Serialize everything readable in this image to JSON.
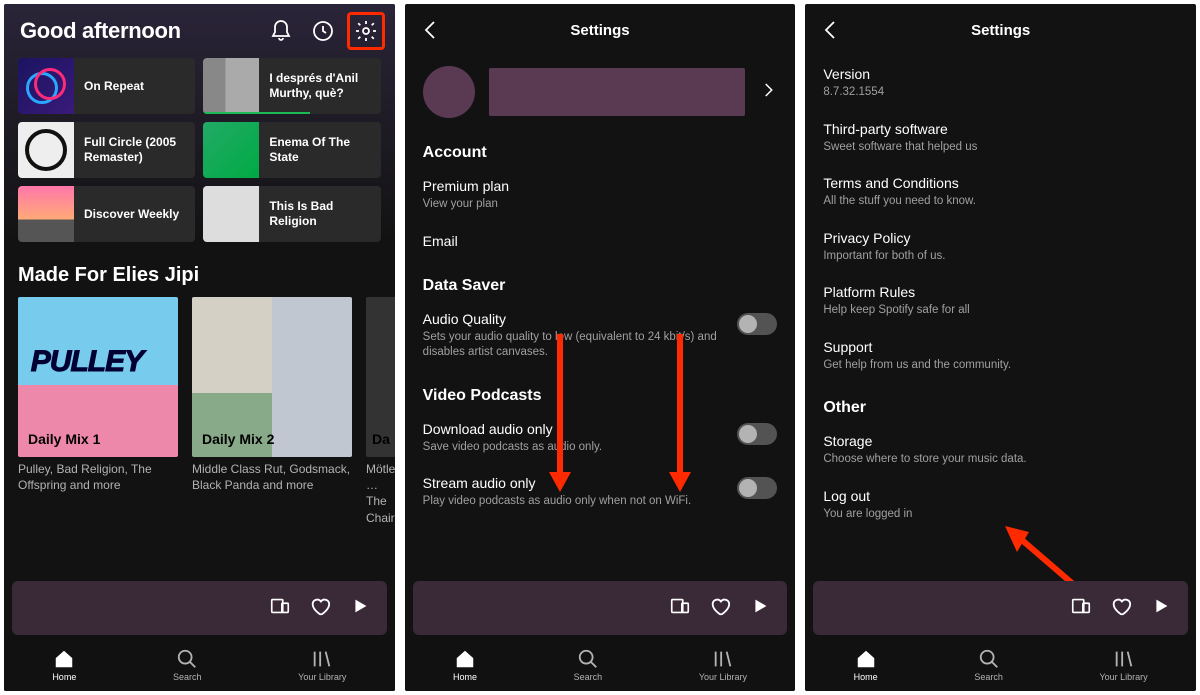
{
  "home": {
    "greeting": "Good afternoon",
    "tiles": [
      {
        "label": "On Repeat"
      },
      {
        "label": "I després d'Anil Murthy, què?"
      },
      {
        "label": "Full Circle (2005 Remaster)"
      },
      {
        "label": "Enema Of The State"
      },
      {
        "label": "Discover Weekly"
      },
      {
        "label": "This Is Bad Religion"
      }
    ],
    "made_for_heading": "Made For Elies Jipi",
    "cards": [
      {
        "name": "Daily Mix 1",
        "logo": "PULLEY",
        "sub": "Pulley, Bad Religion, The Offspring and more"
      },
      {
        "name": "Daily Mix 2",
        "sub": "Middle Class Rut, Godsmack, Black Panda and more"
      },
      {
        "name": "Da",
        "sub": "Mötley …\nThe Chair…"
      }
    ]
  },
  "nav": {
    "home": "Home",
    "search": "Search",
    "library": "Your Library"
  },
  "settings": {
    "title": "Settings",
    "account_head": "Account",
    "premium": {
      "t": "Premium plan",
      "s": "View your plan"
    },
    "email": {
      "t": "Email"
    },
    "datasaver_head": "Data Saver",
    "audio_q": {
      "t": "Audio Quality",
      "s": "Sets your audio quality to low (equivalent to 24 kbit/s) and disables artist canvases."
    },
    "video_head": "Video Podcasts",
    "dl_audio": {
      "t": "Download audio only",
      "s": "Save video podcasts as audio only."
    },
    "stream_audio": {
      "t": "Stream audio only",
      "s": "Play video podcasts as audio only when not on WiFi."
    }
  },
  "settings2": {
    "version": {
      "t": "Version",
      "s": "8.7.32.1554"
    },
    "third": {
      "t": "Third-party software",
      "s": "Sweet software that helped us"
    },
    "terms": {
      "t": "Terms and Conditions",
      "s": "All the stuff you need to know."
    },
    "privacy": {
      "t": "Privacy Policy",
      "s": "Important for both of us."
    },
    "platform": {
      "t": "Platform Rules",
      "s": "Help keep Spotify safe for all"
    },
    "support": {
      "t": "Support",
      "s": "Get help from us and the community."
    },
    "other_head": "Other",
    "storage": {
      "t": "Storage",
      "s": "Choose where to store your music data."
    },
    "logout": {
      "t": "Log out",
      "s": "You are logged in"
    }
  }
}
